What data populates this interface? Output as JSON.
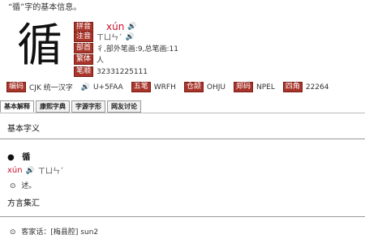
{
  "title": "“循”字的基本信息。",
  "character": "循",
  "rows": [
    {
      "tag": "拼音",
      "value": "xún"
    },
    {
      "tag": "注音",
      "value": "ㄒㄩㄣˊ"
    },
    {
      "tag": "部首",
      "value": "彳,部外笔画:9,总笔画:11"
    },
    {
      "tag": "繁体",
      "value": "人"
    },
    {
      "tag": "笔顺",
      "value": "32331225111"
    }
  ],
  "codes": [
    {
      "tag": "编码",
      "value": "CJK 统一汉字"
    },
    {
      "tag": "",
      "value": "U+5FAA"
    },
    {
      "tag": "五笔",
      "value": "WRFH"
    },
    {
      "tag": "仓颉",
      "value": "OHJU"
    },
    {
      "tag": "郑码",
      "value": "NPEL"
    },
    {
      "tag": "四角",
      "value": "22264"
    }
  ],
  "tabs": [
    "基本解释",
    "康熙字典",
    "字源字形",
    "网友讨论"
  ],
  "basic_title": "基本字义",
  "entry_char": "循",
  "entry_pinyin": "xún",
  "entry_zhuyin": "ㄒㄩㄣˊ",
  "entry_def": "述。",
  "dialect_title": "方言集汇",
  "dialect_item": "客家话：[梅县腔] sun2"
}
